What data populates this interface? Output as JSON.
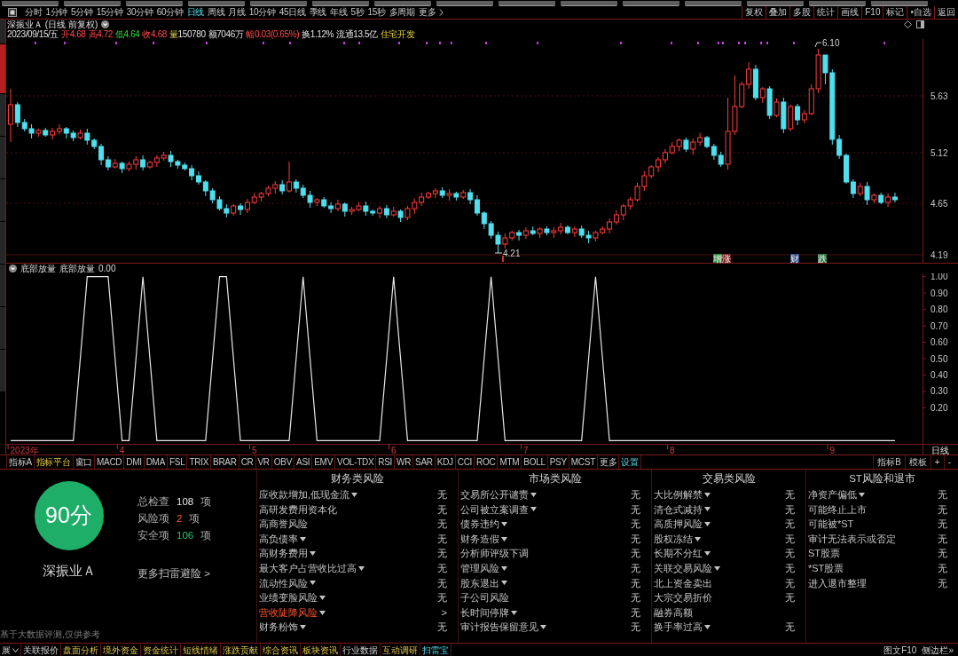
{
  "period_bar": {
    "periods": [
      {
        "label": "分时",
        "selected": false
      },
      {
        "label": "1分钟",
        "selected": false
      },
      {
        "label": "5分钟",
        "selected": false
      },
      {
        "label": "15分钟",
        "selected": false
      },
      {
        "label": "30分钟",
        "selected": false
      },
      {
        "label": "60分钟",
        "selected": false
      },
      {
        "label": "日线",
        "selected": true
      },
      {
        "label": "周线",
        "selected": false
      },
      {
        "label": "月线",
        "selected": false
      },
      {
        "label": "10分钟",
        "selected": false
      },
      {
        "label": "45日线",
        "selected": false
      },
      {
        "label": "季线",
        "selected": false
      },
      {
        "label": "年线",
        "selected": false
      },
      {
        "label": "5秒",
        "selected": false
      },
      {
        "label": "15秒",
        "selected": false
      },
      {
        "label": "多周期",
        "selected": false
      }
    ],
    "more": "更多",
    "tools": [
      "复权",
      "叠加",
      "多股",
      "统计",
      "画线",
      "F10",
      "标记",
      "•自选",
      "返回"
    ]
  },
  "quote_header": {
    "title": "深振业Ａ (日线 前复权)",
    "date": "2023/09/15/五",
    "fields": [
      {
        "label": "开",
        "value": "4.68",
        "kind": "up"
      },
      {
        "label": "高",
        "value": "4.72",
        "kind": "up"
      },
      {
        "label": "低",
        "value": "4.64",
        "kind": "down"
      },
      {
        "label": "收",
        "value": "4.68",
        "kind": "up"
      },
      {
        "label": "量",
        "value": "150780",
        "kind": "volume"
      },
      {
        "label": "额",
        "value": "7046万",
        "kind": "plain"
      },
      {
        "label": "幅",
        "value": "0.03(0.65%)",
        "kind": "up"
      },
      {
        "label": "换",
        "value": "1.12%",
        "kind": "plain"
      },
      {
        "label": "流通",
        "value": "13.5亿",
        "kind": "plain"
      }
    ],
    "industry": "住宅开发"
  },
  "price_chart": {
    "axis_labels": [
      "5.63",
      "5.12",
      "4.65",
      "4.19"
    ],
    "high_mark": "6.10",
    "low_mark": "4.21",
    "events": [
      {
        "label": "增",
        "color": "#2f8f3f"
      },
      {
        "label": "涨",
        "color": "#7a2424"
      },
      {
        "label": "财",
        "color": "#2f4a80"
      },
      {
        "label": "跌",
        "color": "#2f7a3f"
      }
    ]
  },
  "indicator_panel": {
    "current_value": "0.00",
    "period_label": "日线",
    "chart_data": {
      "type": "line",
      "title": "底部放量",
      "categories": [
        null,
        null,
        "2023年",
        null,
        null,
        null,
        null,
        null,
        null,
        null,
        null,
        null,
        null,
        null,
        null,
        null,
        "4",
        null,
        null,
        null,
        null,
        null,
        null,
        null,
        null,
        null,
        null,
        null,
        null,
        null,
        null,
        null,
        null,
        null,
        null,
        "5",
        null,
        null,
        null,
        null,
        null,
        null,
        null,
        null,
        null,
        null,
        null,
        null,
        null,
        null,
        null,
        null,
        null,
        null,
        null,
        "6",
        null,
        null,
        null,
        null,
        null,
        null,
        null,
        null,
        null,
        null,
        null,
        null,
        null,
        null,
        null,
        null,
        null,
        null,
        "7",
        null,
        null,
        null,
        null,
        null,
        null,
        null,
        null,
        null,
        null,
        null,
        null,
        null,
        null,
        null,
        null,
        null,
        null,
        null,
        null,
        "8",
        null,
        null,
        null,
        null,
        null,
        null,
        null,
        null,
        null,
        null,
        null,
        null,
        null,
        null,
        null,
        null,
        null,
        null,
        null,
        null,
        null,
        null,
        "9",
        null,
        null,
        null,
        null,
        null,
        null,
        null,
        null,
        null
      ],
      "ylim": [
        -0.02,
        1.02
      ],
      "yticks": [
        {
          "value": 1,
          "label": "1.00"
        },
        {
          "value": 0.9,
          "label": "0.90"
        },
        {
          "value": 0.8,
          "label": "0.80"
        },
        {
          "value": 0.7,
          "label": "0.70"
        },
        {
          "value": 0.6,
          "label": "0.60"
        },
        {
          "value": 0.5,
          "label": "0.50"
        },
        {
          "value": 0.4,
          "label": "0.40"
        },
        {
          "value": 0.3,
          "label": "0.30"
        },
        {
          "value": 0.2,
          "label": "0.20"
        }
      ],
      "series": [
        {
          "name": "底部放量",
          "color": "#e8e8e8",
          "values": [
            0,
            0,
            0,
            0,
            0,
            0,
            0,
            0,
            0,
            0,
            0.5,
            1,
            1,
            1,
            1,
            0.5,
            0,
            0,
            0.5,
            1,
            0.5,
            0,
            0,
            0,
            0,
            0,
            0,
            0,
            0,
            0.5,
            1,
            1,
            0.5,
            0,
            0,
            0,
            0,
            0,
            0,
            0,
            0,
            0.5,
            1,
            0.5,
            0,
            0,
            0,
            0,
            0,
            0,
            0,
            0,
            0,
            0,
            0.5,
            1,
            0.5,
            0,
            0,
            0,
            0,
            0,
            0,
            0,
            0,
            0,
            0,
            0,
            0.5,
            1,
            0.5,
            0,
            0,
            0,
            0,
            0,
            0,
            0,
            0,
            0,
            0,
            0,
            0,
            0.5,
            1,
            0.5,
            0,
            0,
            0,
            0,
            0,
            0,
            0,
            0,
            0,
            0,
            0,
            0,
            0,
            0,
            0,
            0,
            0,
            0,
            0,
            0,
            0,
            0,
            0,
            0,
            0,
            0,
            0,
            0,
            0,
            0,
            0,
            0,
            0,
            0,
            0,
            0,
            0,
            0,
            0,
            0,
            0,
            0
          ]
        }
      ]
    }
  },
  "indicator_tabs": {
    "tabs": [
      {
        "label": "指标A",
        "kind": "tab"
      },
      {
        "label": "指标平台",
        "kind": "platform"
      },
      {
        "label": "窗口",
        "kind": "tab"
      },
      {
        "label": "MACD",
        "kind": "tab"
      },
      {
        "label": "DMI",
        "kind": "tab"
      },
      {
        "label": "DMA",
        "kind": "tab"
      },
      {
        "label": "FSL",
        "kind": "tab"
      },
      {
        "label": "TRIX",
        "kind": "tab"
      },
      {
        "label": "BRAR",
        "kind": "tab"
      },
      {
        "label": "CR",
        "kind": "tab"
      },
      {
        "label": "VR",
        "kind": "tab"
      },
      {
        "label": "OBV",
        "kind": "tab"
      },
      {
        "label": "ASI",
        "kind": "tab"
      },
      {
        "label": "EMV",
        "kind": "tab"
      },
      {
        "label": "VOL-TDX",
        "kind": "tab"
      },
      {
        "label": "RSI",
        "kind": "tab"
      },
      {
        "label": "WR",
        "kind": "tab"
      },
      {
        "label": "SAR",
        "kind": "tab"
      },
      {
        "label": "KDJ",
        "kind": "tab"
      },
      {
        "label": "CCI",
        "kind": "tab"
      },
      {
        "label": "ROC",
        "kind": "tab"
      },
      {
        "label": "MTM",
        "kind": "tab"
      },
      {
        "label": "BOLL",
        "kind": "tab"
      },
      {
        "label": "PSY",
        "kind": "tab"
      },
      {
        "label": "MCST",
        "kind": "tab"
      },
      {
        "label": "更多",
        "kind": "tab"
      },
      {
        "label": "设置",
        "kind": "settings"
      }
    ],
    "right": [
      "指标B",
      "模板",
      "+",
      "-"
    ]
  },
  "risk_scan": {
    "score": "90分",
    "stock_name": "深振业Ａ",
    "stats": [
      {
        "label": "总检查",
        "count": "108",
        "unit": "项",
        "kind": "total"
      },
      {
        "label": "风险项",
        "count": "2",
        "unit": "项",
        "kind": "risk"
      },
      {
        "label": "安全项",
        "count": "106",
        "unit": "项",
        "kind": "safe"
      }
    ],
    "more_link": "更多扫雷避险 >",
    "disclaimer": "基于大数据评测,仅供参考",
    "categories": [
      {
        "title": "财务类风险",
        "items": [
          {
            "label": "应收款增加,低现金流",
            "expandable": true,
            "risk": false,
            "result": "无"
          },
          {
            "label": "高研发费用资本化",
            "expandable": false,
            "risk": false,
            "result": "无"
          },
          {
            "label": "高商誉风险",
            "expandable": false,
            "risk": false,
            "result": "无"
          },
          {
            "label": "高负债率",
            "expandable": true,
            "risk": false,
            "result": "无"
          },
          {
            "label": "高财务费用",
            "expandable": true,
            "risk": false,
            "result": "无"
          },
          {
            "label": "最大客户占营收比过高",
            "expandable": true,
            "risk": false,
            "result": "无"
          },
          {
            "label": "流动性风险",
            "expandable": true,
            "risk": false,
            "result": "无"
          },
          {
            "label": "业绩变脸风险",
            "expandable": true,
            "risk": false,
            "result": "无"
          },
          {
            "label": "营收陡降风险",
            "expandable": true,
            "risk": true,
            "result": ">"
          },
          {
            "label": "财务粉饰",
            "expandable": true,
            "risk": false,
            "result": "无"
          }
        ]
      },
      {
        "title": "市场类风险",
        "items": [
          {
            "label": "交易所公开谴责",
            "expandable": true,
            "risk": false,
            "result": "无"
          },
          {
            "label": "公司被立案调查",
            "expandable": true,
            "risk": false,
            "result": "无"
          },
          {
            "label": "债券违约",
            "expandable": true,
            "risk": false,
            "result": "无"
          },
          {
            "label": "财务造假",
            "expandable": true,
            "risk": false,
            "result": "无"
          },
          {
            "label": "分析师评级下调",
            "expandable": false,
            "risk": false,
            "result": "无"
          },
          {
            "label": "管理风险",
            "expandable": true,
            "risk": false,
            "result": "无"
          },
          {
            "label": "股东退出",
            "expandable": true,
            "risk": false,
            "result": "无"
          },
          {
            "label": "子公司风险",
            "expandable": false,
            "risk": false,
            "result": "无"
          },
          {
            "label": "长时间停牌",
            "expandable": true,
            "risk": false,
            "result": "无"
          },
          {
            "label": "审计报告保留意见",
            "expandable": true,
            "risk": false,
            "result": "无"
          }
        ]
      },
      {
        "title": "交易类风险",
        "items": [
          {
            "label": "大比例解禁",
            "expandable": true,
            "risk": false,
            "result": "无"
          },
          {
            "label": "清仓式减持",
            "expandable": true,
            "risk": false,
            "result": "无"
          },
          {
            "label": "高质押风险",
            "expandable": true,
            "risk": false,
            "result": "无"
          },
          {
            "label": "股权冻结",
            "expandable": true,
            "risk": false,
            "result": "无"
          },
          {
            "label": "长期不分红",
            "expandable": true,
            "risk": false,
            "result": "无"
          },
          {
            "label": "关联交易风险",
            "expandable": true,
            "risk": false,
            "result": "无"
          },
          {
            "label": "北上资金卖出",
            "expandable": false,
            "risk": false,
            "result": "无"
          },
          {
            "label": "大宗交易折价",
            "expandable": false,
            "risk": false,
            "result": "无"
          },
          {
            "label": "融券高额",
            "expandable": false,
            "risk": false
          },
          {
            "label": "换手率过高",
            "expandable": true,
            "risk": false,
            "result": "无"
          }
        ]
      },
      {
        "title": "ST风险和退市",
        "items": [
          {
            "label": "净资产偏低",
            "expandable": true,
            "risk": false,
            "result": "无"
          },
          {
            "label": "可能终止上市",
            "expandable": false,
            "risk": false,
            "result": "无"
          },
          {
            "label": "可能被*ST",
            "expandable": false,
            "risk": false,
            "result": "无"
          },
          {
            "label": "审计无法表示或否定",
            "expandable": false,
            "risk": false,
            "result": "无"
          },
          {
            "label": "ST股票",
            "expandable": false,
            "risk": false,
            "result": "无"
          },
          {
            "label": "*ST股票",
            "expandable": false,
            "risk": false,
            "result": "无"
          },
          {
            "label": "进入退市整理",
            "expandable": false,
            "risk": false,
            "result": "无"
          }
        ]
      }
    ]
  },
  "bottom_tabs": {
    "tabs": [
      {
        "label": "展",
        "kind": "menu",
        "selected": false
      },
      {
        "label": "关联报价",
        "kind": "plain",
        "selected": false
      },
      {
        "label": "盘面分析",
        "kind": "info",
        "selected": false
      },
      {
        "label": "境外资金",
        "kind": "info",
        "selected": false
      },
      {
        "label": "资金统计",
        "kind": "info",
        "selected": false
      },
      {
        "label": "短线情绪",
        "kind": "info",
        "selected": false
      },
      {
        "label": "涨跌贡献",
        "kind": "info",
        "selected": false
      },
      {
        "label": "综合资讯",
        "kind": "info",
        "selected": false
      },
      {
        "label": "板块资讯",
        "kind": "info",
        "selected": false
      },
      {
        "label": "行业数据",
        "kind": "plain",
        "selected": false
      },
      {
        "label": "互动调研",
        "kind": "info",
        "selected": false
      },
      {
        "label": "扫雷宝",
        "kind": "info",
        "selected": true
      }
    ],
    "right": [
      "图文F10",
      "侧边栏»"
    ]
  }
}
